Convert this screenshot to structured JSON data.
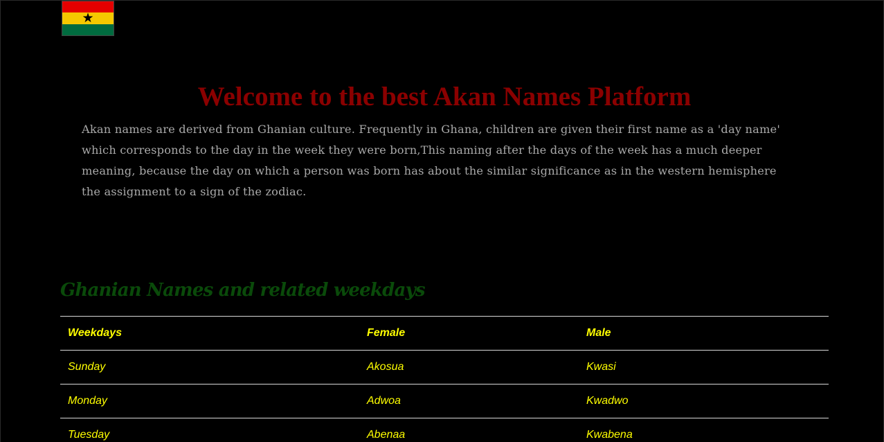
{
  "colors": {
    "background": "#000000",
    "heading": "#8b0000",
    "body_text": "#a9a9a9",
    "section_title": "#0a4a0a",
    "table_text": "#ffff00",
    "table_border": "#d9d9d9",
    "flag_red": "#e40000",
    "flag_gold": "#f5c800",
    "flag_green": "#006b3f"
  },
  "flag": {
    "icon": "ghana-flag-icon",
    "star": "★"
  },
  "header": {
    "title": "Welcome to the best Akan Names Platform",
    "intro": "Akan names are derived from Ghanian culture. Frequently in Ghana, children are given their first name as a 'day name' which corresponds to the day in the week they were born,This naming after the days of the week has a much deeper meaning, because the day on which a person was born has about the similar significance as in the western hemisphere the assignment to a sign of the zodiac."
  },
  "names_section": {
    "title": "Ghanian Names and related weekdays",
    "table": {
      "headers": [
        "Weekdays",
        "Female",
        "Male"
      ],
      "rows": [
        [
          "Sunday",
          "Akosua",
          "Kwasi"
        ],
        [
          "Monday",
          "Adwoa",
          "Kwadwo"
        ],
        [
          "Tuesday",
          "Abenaa",
          "Kwabena"
        ]
      ]
    }
  }
}
